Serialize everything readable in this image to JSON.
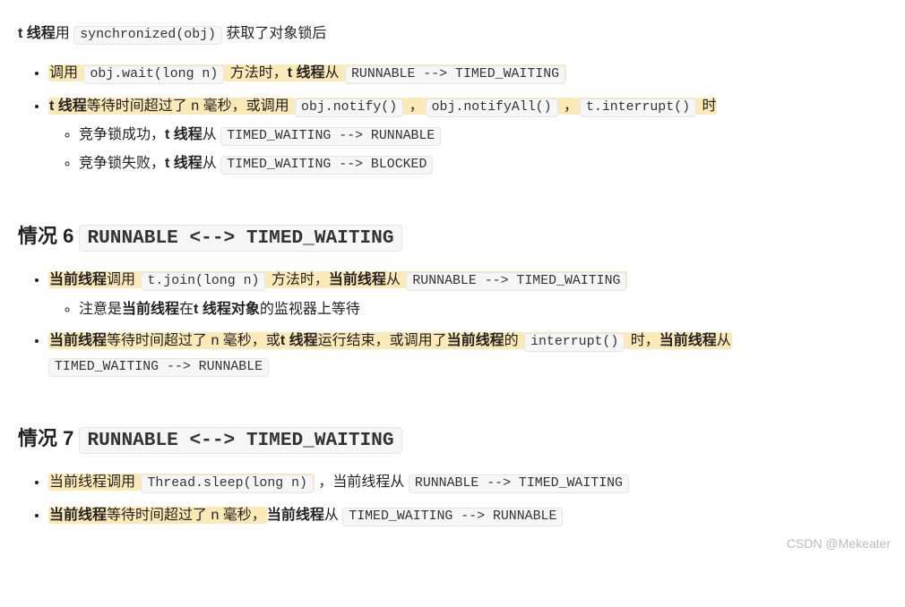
{
  "intro": {
    "prefix_bold": "t 线程",
    "prefix_text": "用 ",
    "code1": "synchronized(obj)",
    "suffix": " 获取了对象锁后"
  },
  "list1": {
    "item1": {
      "t1": "调用 ",
      "code1": "obj.wait(long n)",
      "t2": " 方法时，",
      "b1": "t 线程",
      "t3": "从 ",
      "code2": "RUNNABLE --> TIMED_WAITING"
    },
    "item2": {
      "b1": "t 线程",
      "t1": "等待时间超过了 n 毫秒，或调用 ",
      "code1": "obj.notify()",
      "sep1": " ，",
      "code2": "obj.notifyAll()",
      "sep2": " ，",
      "code3": "t.interrupt()",
      "t2": " 时",
      "sub1": {
        "t1": "竞争锁成功，",
        "b1": "t 线程",
        "t2": "从 ",
        "code1": "TIMED_WAITING --> RUNNABLE"
      },
      "sub2": {
        "t1": "竞争锁失败，",
        "b1": "t 线程",
        "t2": "从 ",
        "code1": "TIMED_WAITING --> BLOCKED"
      }
    }
  },
  "case6": {
    "title_prefix": "情况 6 ",
    "title_code": "RUNNABLE <--> TIMED_WAITING",
    "item1": {
      "b1": "当前线程",
      "t1": "调用 ",
      "code1": "t.join(long n)",
      "t2": " 方法时，",
      "b2": "当前线程",
      "t3": "从 ",
      "code2": "RUNNABLE --> TIMED_WAITING",
      "sub1": {
        "t1": "注意是",
        "b1": "当前线程",
        "t2": "在",
        "b2": "t 线程对象",
        "t3": "的监视器上等待"
      }
    },
    "item2": {
      "b1": "当前线程",
      "t1": "等待时间超过了 n 毫秒，或",
      "b2": "t 线程",
      "t2": "运行结束，或调用了",
      "b3": "当前线程",
      "t3": "的 ",
      "code1": "interrupt()",
      "t4": " 时，",
      "b4": "当前线程",
      "t5": "从",
      "code2": "TIMED_WAITING --> RUNNABLE"
    }
  },
  "case7": {
    "title_prefix": "情况 7 ",
    "title_code": "RUNNABLE <--> TIMED_WAITING",
    "item1": {
      "t1": "当前线程调用 ",
      "code1": "Thread.sleep(long n)",
      "t2": " ，当前线程从 ",
      "code2": "RUNNABLE --> TIMED_WAITING"
    },
    "item2": {
      "b1": "当前线程",
      "t1": "等待时间超过了 n 毫秒，",
      "b2": "当前线程",
      "t2": "从 ",
      "code1": "TIMED_WAITING --> RUNNABLE"
    }
  },
  "watermark": "CSDN @Mekeater"
}
